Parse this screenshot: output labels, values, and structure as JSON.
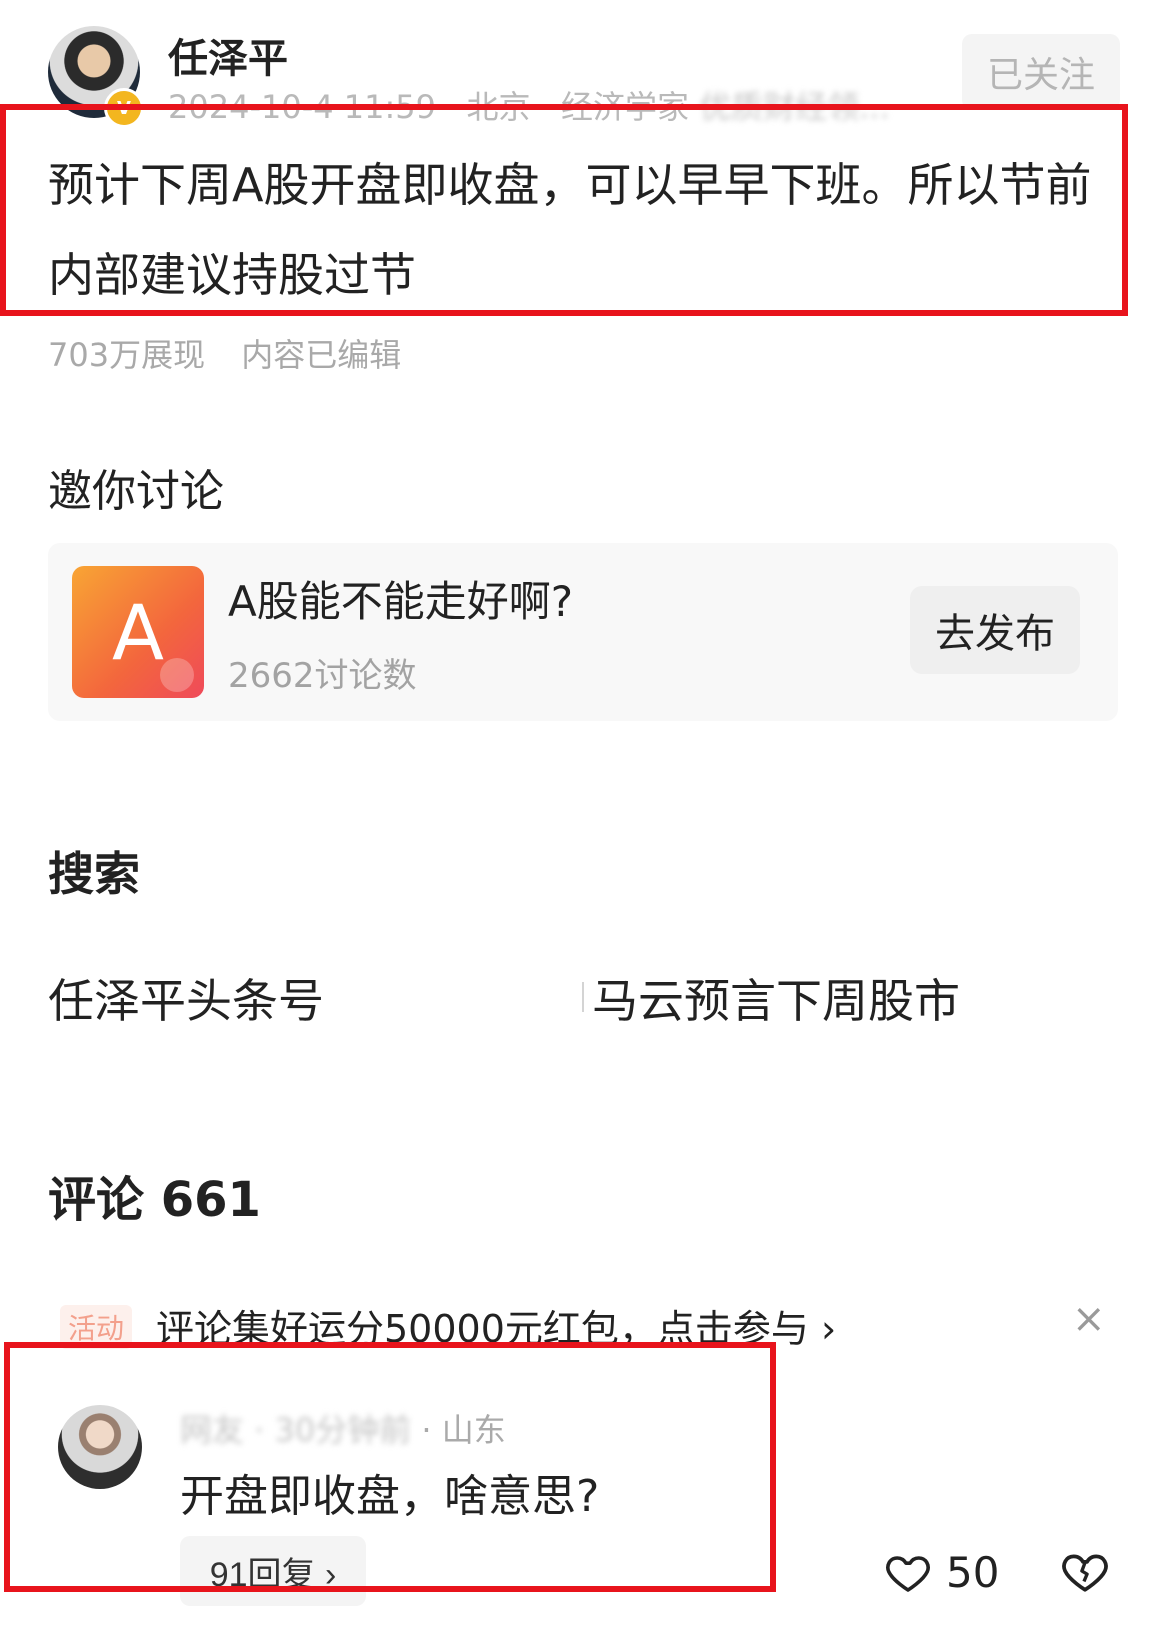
{
  "post": {
    "author": "任泽平",
    "verified_badge": "V",
    "meta_visible": "2024-10-4 11:59 · 北京 · 经济学家",
    "meta_blurred": "优质财经领...",
    "follow_label": "已关注",
    "text": "预计下周A股开盘即收盘，可以早早下班。所以节前内部建议持股过节",
    "views": "703万展现",
    "edited": "内容已编辑"
  },
  "discuss": {
    "heading": "邀你讨论",
    "icon_letter": "A",
    "topic": "A股能不能走好啊?",
    "count": "2662讨论数",
    "publish_label": "去发布"
  },
  "search": {
    "heading": "搜索",
    "queries": [
      "任泽平头条号",
      "马云预言下周股市"
    ]
  },
  "comments": {
    "heading": "评论 661",
    "banner_tag": "活动",
    "banner_text": "评论集好运分50000元红包，点击参与 ›",
    "banner_close": "×",
    "item": {
      "user_blurred": "网友 · 30分钟前",
      "location": " · 山东",
      "text": "开盘即收盘，啥意思?",
      "replies_label": "91回复 ›",
      "likes": "50"
    }
  },
  "colors": {
    "highlight_box": "#e8141c",
    "topic_icon_gradient": [
      "#f8a534",
      "#ef4a5a"
    ],
    "badge": "#f3b61f"
  },
  "icons": {
    "like": "heart-outline-icon",
    "dislike": "broken-heart-icon",
    "close": "close-icon"
  }
}
